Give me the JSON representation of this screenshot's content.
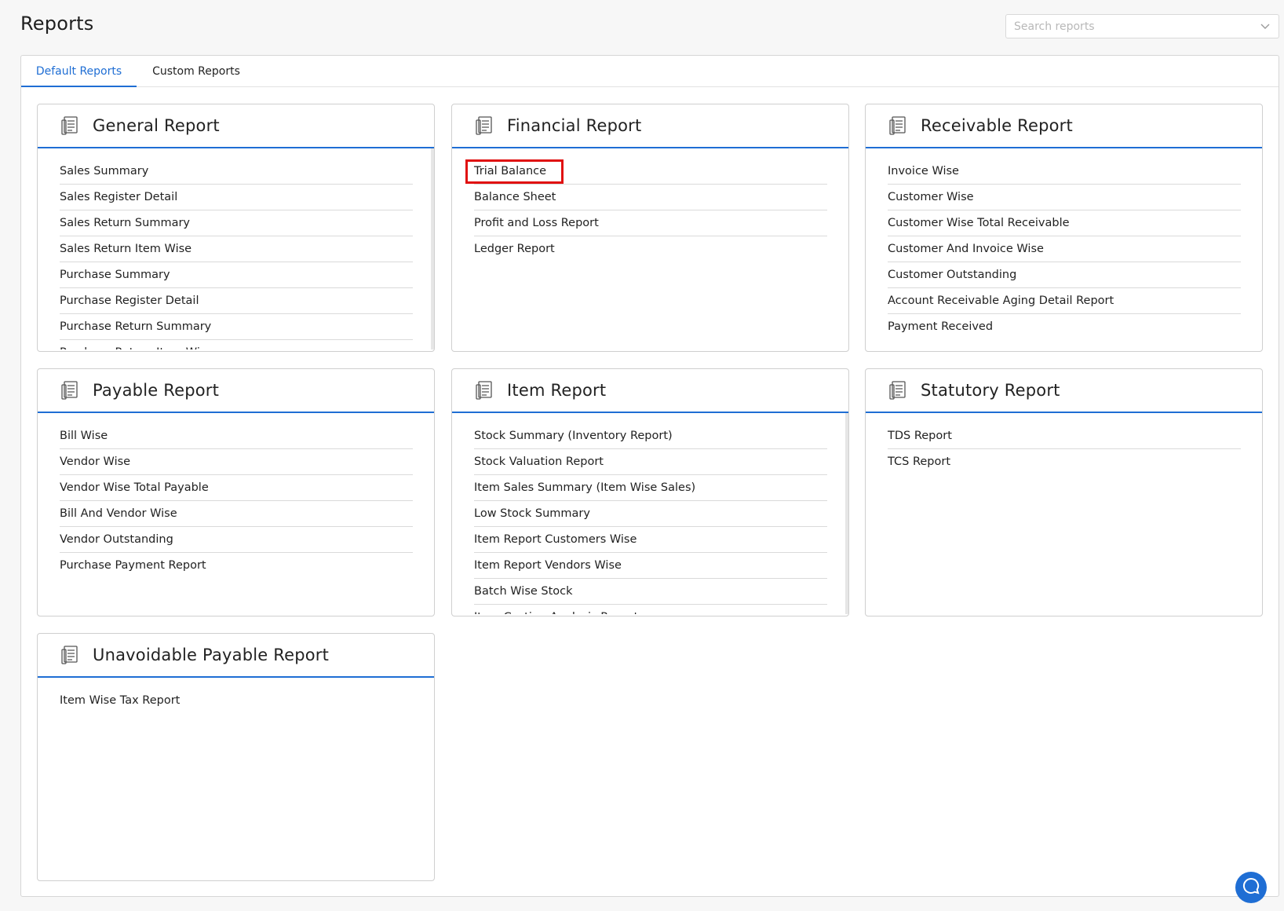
{
  "page": {
    "title": "Reports"
  },
  "search": {
    "placeholder": "Search reports"
  },
  "tabs": [
    {
      "label": "Default Reports",
      "active": true
    },
    {
      "label": "Custom Reports",
      "active": false
    }
  ],
  "cards": {
    "general": {
      "title": "General Report",
      "items": [
        "Sales Summary",
        "Sales Register Detail",
        "Sales Return Summary",
        "Sales Return Item Wise",
        "Purchase Summary",
        "Purchase Register Detail",
        "Purchase Return Summary",
        "Purchase Return Item Wise"
      ]
    },
    "financial": {
      "title": "Financial Report",
      "items": [
        "Trial Balance",
        "Balance Sheet",
        "Profit and Loss Report",
        "Ledger Report"
      ]
    },
    "receivable": {
      "title": "Receivable Report",
      "items": [
        "Invoice Wise",
        "Customer Wise",
        "Customer Wise Total Receivable",
        "Customer And Invoice Wise",
        "Customer Outstanding",
        "Account Receivable Aging Detail Report",
        "Payment Received"
      ]
    },
    "payable": {
      "title": "Payable Report",
      "items": [
        "Bill Wise",
        "Vendor Wise",
        "Vendor Wise Total Payable",
        "Bill And Vendor Wise",
        "Vendor Outstanding",
        "Purchase Payment Report"
      ]
    },
    "item": {
      "title": "Item Report",
      "items": [
        "Stock Summary (Inventory Report)",
        "Stock Valuation Report",
        "Item Sales Summary (Item Wise Sales)",
        "Low Stock Summary",
        "Item Report Customers Wise",
        "Item Report Vendors Wise",
        "Batch Wise Stock",
        "Item Costing Analysis Report"
      ]
    },
    "statutory": {
      "title": "Statutory Report",
      "items": [
        "TDS Report",
        "TCS Report"
      ]
    },
    "unavoidable": {
      "title": "Unavoidable Payable Report",
      "items": [
        "Item Wise Tax Report"
      ]
    }
  },
  "colors": {
    "accent": "#1f6ed4",
    "highlight": "#e01010"
  },
  "icons": {
    "card": "report-book-icon",
    "search": "chevron-down-icon",
    "chat": "chat-bubble-icon"
  }
}
